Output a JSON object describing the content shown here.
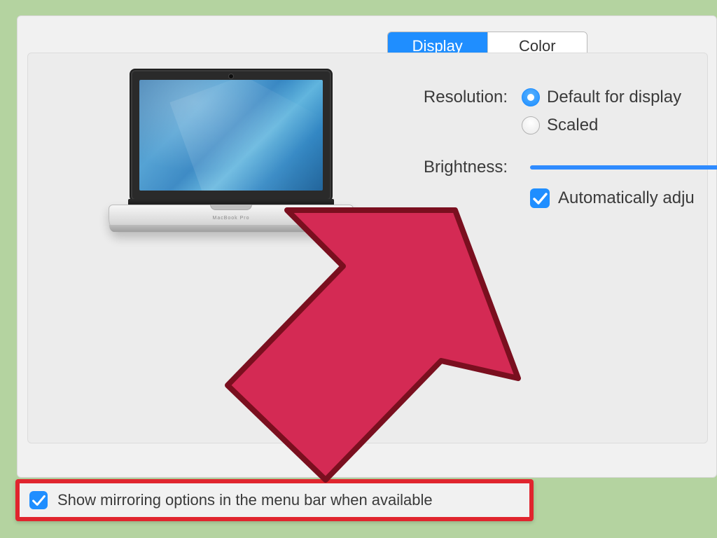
{
  "tabs": {
    "display": "Display",
    "color": "Color"
  },
  "resolution": {
    "label": "Resolution:",
    "option_default": "Default for display",
    "option_scaled": "Scaled"
  },
  "brightness": {
    "label": "Brightness:",
    "auto_label": "Automatically adju"
  },
  "mirroring": {
    "label": "Show mirroring options in the menu bar when available"
  },
  "laptop_brand": "MacBook Pro",
  "colors": {
    "accent": "#1f8eff",
    "highlight": "#e0252e",
    "arrow_fill": "#d42a54",
    "arrow_stroke": "#7a0f1f"
  }
}
